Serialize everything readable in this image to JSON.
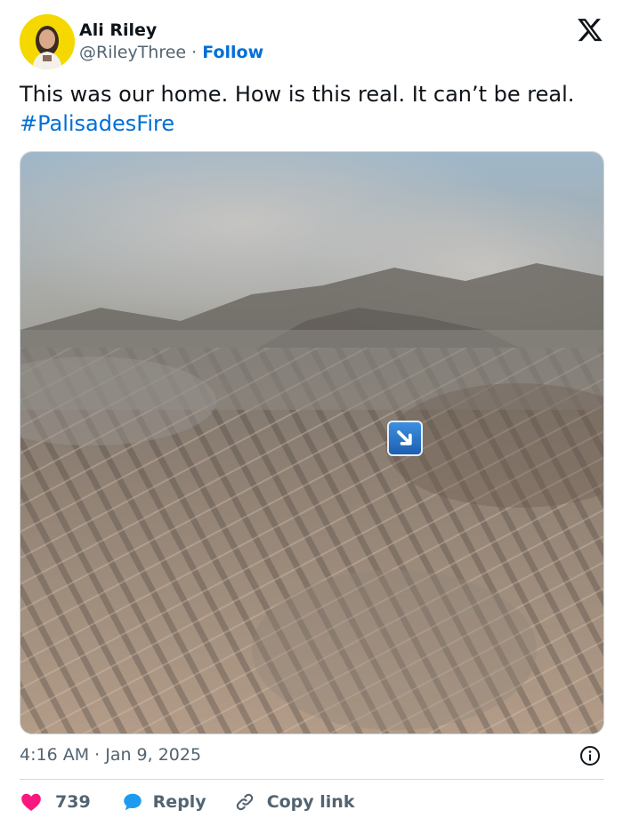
{
  "author": {
    "name": "Ali Riley",
    "handle": "@RileyThree",
    "separator": "·",
    "follow_label": "Follow",
    "avatar_icon": "avatar-photo"
  },
  "platform_icon": "x-logo-icon",
  "tweet": {
    "text": "This was our home. How is this real. It can’t be real.",
    "hashtag": "#PalisadesFire"
  },
  "media": {
    "overlay_icon": "arrow-down-right-emoji-icon"
  },
  "timestamp": "4:16 AM · Jan 9, 2025",
  "actions": {
    "like_count": "739",
    "reply_label": "Reply",
    "copy_link_label": "Copy link"
  },
  "colors": {
    "accent": "#006fd6",
    "like": "#f91880",
    "reply": "#1d9bf0",
    "text": "#0f1419",
    "muted": "#536471"
  }
}
